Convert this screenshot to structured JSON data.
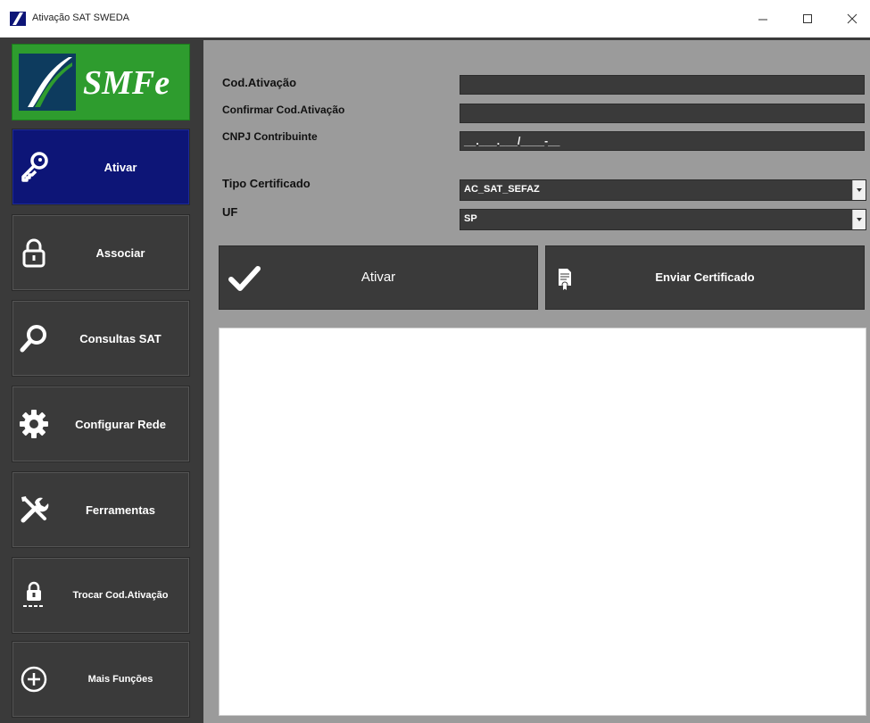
{
  "window": {
    "title": "Ativação SAT SWEDA",
    "controls": [
      "minimize-icon",
      "maximize-icon",
      "close-icon"
    ]
  },
  "logo": {
    "text": "SMFe",
    "color": "#2e9c2e"
  },
  "sidebar": {
    "items": [
      {
        "label": "Ativar",
        "icon": "key-icon",
        "active": true
      },
      {
        "label": "Associar",
        "icon": "lock-icon",
        "active": false
      },
      {
        "label": "Consultas SAT",
        "icon": "magnifier-icon",
        "active": false
      },
      {
        "label": "Configurar Rede",
        "icon": "gear-icon",
        "active": false
      },
      {
        "label": "Ferramentas",
        "icon": "tools-icon",
        "active": false
      },
      {
        "label": "Trocar Cod.Ativação",
        "icon": "lock-password-icon",
        "active": false
      },
      {
        "label": "Mais Funções",
        "icon": "plus-circle-icon",
        "active": false
      }
    ],
    "active_color": "#0d1577"
  },
  "form": {
    "cod_ativacao": {
      "label": "Cod.Ativação",
      "value": ""
    },
    "confirmar": {
      "label": "Confirmar Cod.Ativação",
      "value": ""
    },
    "cnpj": {
      "label": "CNPJ Contribuinte",
      "value": "__.___.___/____-__"
    },
    "tipo_certificado": {
      "label": "Tipo Certificado",
      "value": "AC_SAT_SEFAZ"
    },
    "uf": {
      "label": "UF",
      "value": "SP"
    }
  },
  "actions": {
    "ativar": {
      "label": "Ativar",
      "icon": "checkmark-icon"
    },
    "enviar": {
      "label": "Enviar Certificado",
      "icon": "certificate-document-icon"
    }
  },
  "output": {
    "text": ""
  }
}
